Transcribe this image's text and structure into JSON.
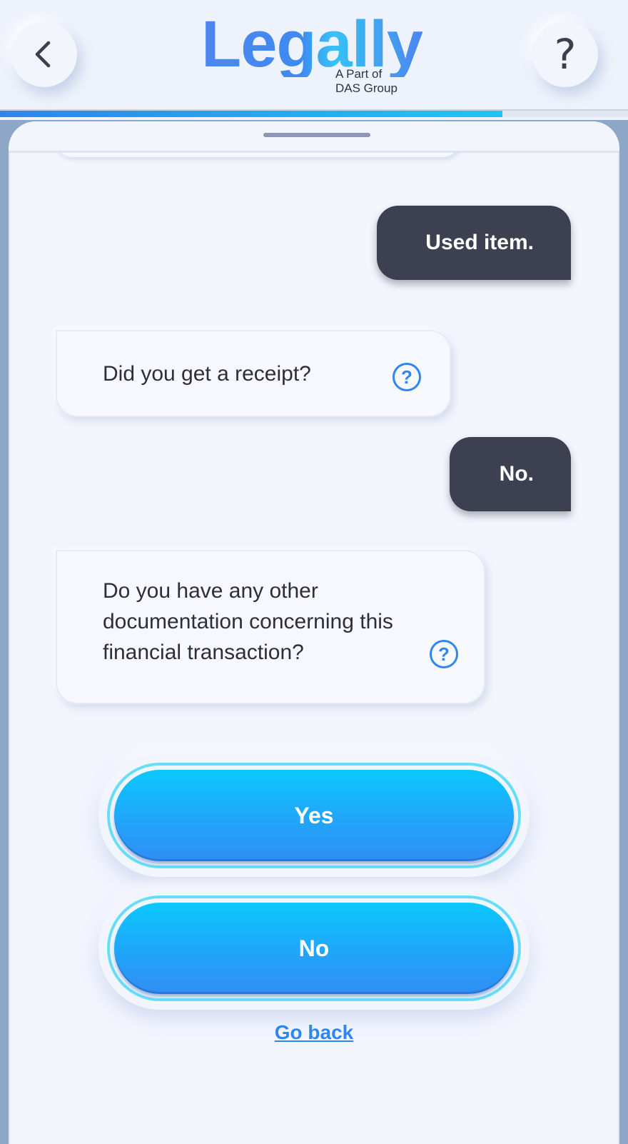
{
  "header": {
    "logo_text": "Legally",
    "logo_sub_line1": "A Part of",
    "logo_sub_line2": "DAS Group",
    "back_icon": "chevron-left-icon",
    "help_label": "?"
  },
  "progress": {
    "fraction": 0.8
  },
  "chat": {
    "messages": [
      {
        "from": "user",
        "text": "Used item."
      },
      {
        "from": "bot",
        "text": "Did you get a receipt?",
        "has_help_icon": true
      },
      {
        "from": "user",
        "text": "No."
      },
      {
        "from": "bot",
        "text": "Do you have any other documentation concerning this financial transaction?",
        "has_help_icon": true
      }
    ],
    "help_icon_glyph": "?"
  },
  "answers": {
    "yes_label": "Yes",
    "no_label": "No"
  },
  "go_back_label": "Go back",
  "colors": {
    "accent": "#2f86ee",
    "user_bubble": "#3d4050",
    "button_top": "#0bc8fd",
    "button_bottom": "#2f8ef3"
  }
}
